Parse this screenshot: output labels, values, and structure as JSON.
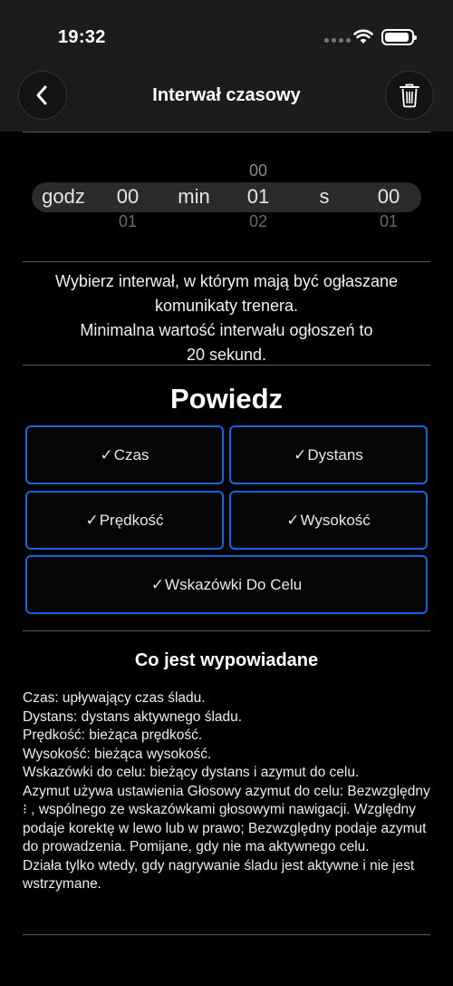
{
  "status_bar": {
    "time": "19:32"
  },
  "nav": {
    "title": "Interwał czasowy",
    "back_icon": "chevron-left-icon",
    "trash_icon": "trash-icon"
  },
  "picker": {
    "hours_label": "godz",
    "hours_value": "00",
    "hours_below": "01",
    "minutes_label": "min",
    "minutes_above": "00",
    "minutes_value": "01",
    "minutes_below": "02",
    "seconds_label": "s",
    "seconds_value": "00",
    "seconds_below": "01"
  },
  "info": {
    "line1": "Wybierz interwał, w którym mają być ogłaszane",
    "line2": "komunikaty trenera.",
    "line3": "Minimalna wartość interwału ogłoszeń to",
    "line4": "20 sekund."
  },
  "say": {
    "title": "Powiedz",
    "check_glyph": "✓",
    "options": [
      {
        "label": "Czas"
      },
      {
        "label": "Dystans"
      },
      {
        "label": "Prędkość"
      },
      {
        "label": "Wysokość"
      },
      {
        "label": "Wskazówki Do Celu"
      }
    ],
    "accent_color": "#1565e0"
  },
  "what": {
    "title": "Co jest wypowiadane",
    "lines": [
      "Czas: upływający czas śladu.",
      "Dystans: dystans aktywnego śladu.",
      "Prędkość: bieżąca prędkość.",
      "Wysokość: bieżąca wysokość.",
      "Wskazówki do celu: bieżący dystans i azymut do celu.",
      "Azymut używa ustawienia Głosowy azymut do celu: Bezwzględny ⁝ , wspólnego ze wskazówkami głosowymi nawigacji. Względny podaje korektę w lewo lub w prawo; Bezwzględny podaje azymut do prowadzenia. Pomijane, gdy nie ma aktywnego celu.",
      "Działa tylko wtedy, gdy nagrywanie śladu jest aktywne i nie jest wstrzymane."
    ]
  }
}
